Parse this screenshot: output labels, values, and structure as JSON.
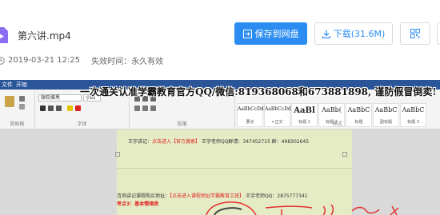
{
  "file": {
    "name": "第六讲.mp4",
    "date": "2019-03-21 12:25",
    "expire": "失效时间：永久有效"
  },
  "buttons": {
    "save": "保存到网盘",
    "download": "下载(31.6M)"
  },
  "icons": {
    "file": "video-file-icon",
    "save": "save-to-disk-icon",
    "download": "download-icon",
    "qr": "qr-code-icon",
    "clock": "clock-icon"
  },
  "colors": {
    "accent": "#2b8cf2",
    "file_icon": "#8a6df0",
    "ribbon_blue": "#2a5699",
    "page_bg": "#e5ecc5",
    "red_text": "#e02020"
  },
  "video": {
    "watermark": "一次通关认准学霸教育官方QQ/微信:819368068和673881898, 谨防假冒倒卖!",
    "word": {
      "tab_file": "文件",
      "tab_start": "开始",
      "font_name": "微软雅黑",
      "font_size": "小四",
      "group_labels": [
        "剪贴板",
        "字体",
        "段落",
        "样式"
      ],
      "styles": [
        {
          "sample": "AaBbCcDd",
          "name": "要点"
        },
        {
          "sample": "AaBbCcDd",
          "name": "↵正文"
        },
        {
          "sample": "AaBl",
          "name": "标题 1"
        },
        {
          "sample": "AaBb(",
          "name": "标题 2"
        },
        {
          "sample": "AaBbC",
          "name": "标题"
        },
        {
          "sample": "AaBbC",
          "name": "副标题"
        },
        {
          "sample": "AaBbC",
          "name": "标题 3"
        }
      ],
      "doc_lines": [
        {
          "prefix": "王宇讲记",
          "link": "点击进入【官方搜索】",
          "suffix": "王宇老师QQ群请：347452715  群：498302645"
        },
        {
          "prefix": "咨询讲记课程购买地址：",
          "link": "【点击进入课程地址学霸教育工班】",
          "suffix": "王宇老师QQ：2875777341"
        },
        {
          "prefix": "考点3：基本情绪类",
          "link": "",
          "suffix": ""
        }
      ]
    }
  }
}
